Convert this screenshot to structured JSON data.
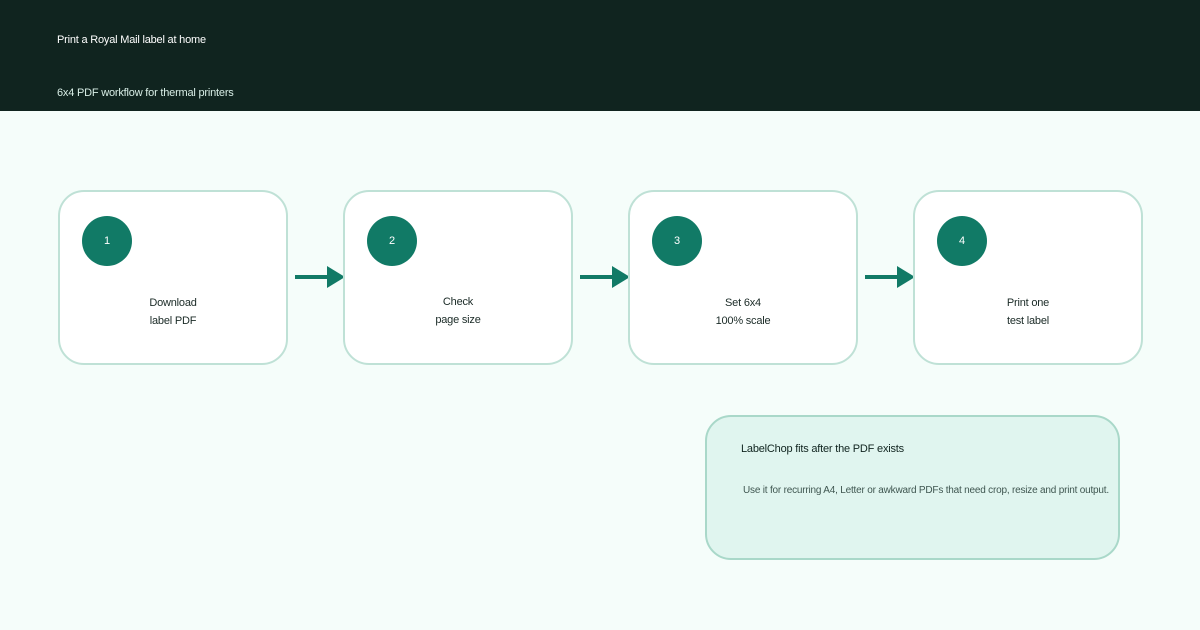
{
  "header": {
    "title": "Print a Royal Mail label at home",
    "subtitle": "6x4 PDF workflow for thermal printers"
  },
  "steps": [
    {
      "number": "1",
      "line1": "Download",
      "line2": "label PDF"
    },
    {
      "number": "2",
      "line1": "Check",
      "line2": "page size"
    },
    {
      "number": "3",
      "line1": "Set 6x4",
      "line2": "100% scale"
    },
    {
      "number": "4",
      "line1": "Print one",
      "line2": "test label"
    }
  ],
  "note": {
    "title": "LabelChop fits after the PDF exists",
    "body": "Use it for recurring A4, Letter or awkward PDFs that need crop, resize and print output."
  },
  "colors": {
    "header_bg": "#10241f",
    "accent": "#117a66",
    "card_border": "#bfe1d6",
    "note_bg": "#e0f5ef",
    "page_bg": "#f5fdfa"
  }
}
